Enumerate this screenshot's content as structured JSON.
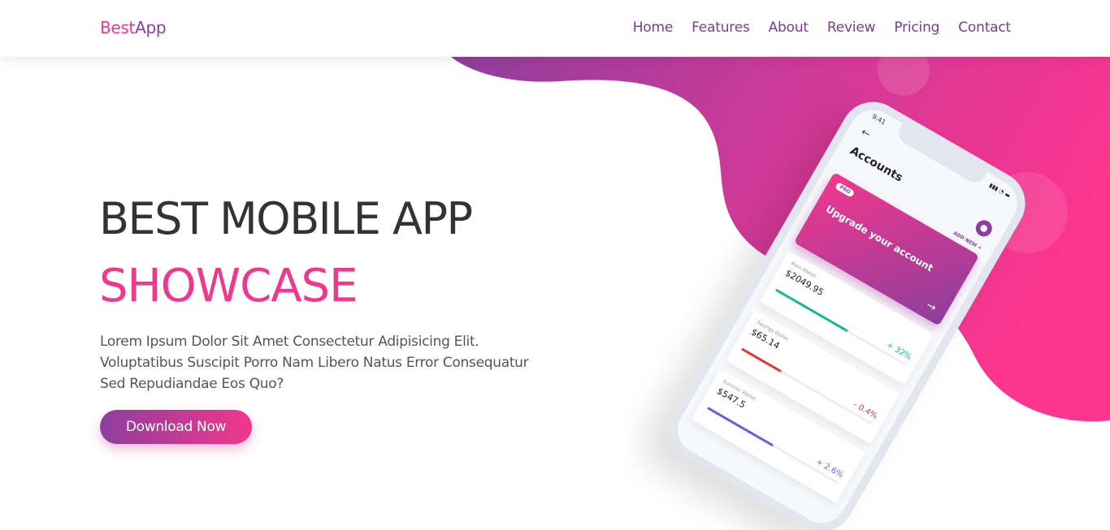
{
  "brand": {
    "part1": "Best",
    "part2": "App"
  },
  "nav": {
    "items": [
      "Home",
      "Features",
      "About",
      "Review",
      "Pricing",
      "Contact"
    ]
  },
  "hero": {
    "title": "BEST MOBILE APP",
    "subtitle": "SHOWCASE",
    "description": "Lorem Ipsum Dolor Sit Amet Consectetur Adipisicing Elit. Voluptatibus Suscipit Porro Nam Libero Natus Error Consequatur Sed Repudiandae Eos Quo?",
    "cta_label": "Download Now"
  },
  "phone": {
    "time": "9:41",
    "screen_title": "Accounts",
    "add_new": "ADD NEW",
    "pro_badge": "PRO",
    "upgrade_label": "Upgrade your account",
    "cards": [
      {
        "name": "Main Wallet",
        "amount": "$2049.95",
        "change": "+ 32%",
        "progress": 0.55,
        "color": "#17b890"
      },
      {
        "name": "Savings Wallet",
        "amount": "$65.14",
        "change": "- 0.4%",
        "progress": 0.3,
        "color": "#e0393e"
      },
      {
        "name": "Summer Wallet",
        "amount": "$547.5",
        "change": "+ 2.6%",
        "progress": 0.5,
        "color": "#6c5ce7"
      }
    ]
  },
  "colors": {
    "accent_pink": "#f2378d",
    "accent_purple": "#8d3e9c",
    "nav_text": "#7a3d95",
    "heading": "#333333"
  },
  "icons": {
    "back": "arrow-left-icon",
    "avatar": "user-icon",
    "add": "plus-icon",
    "upgrade_arrow": "arrow-right-icon"
  }
}
